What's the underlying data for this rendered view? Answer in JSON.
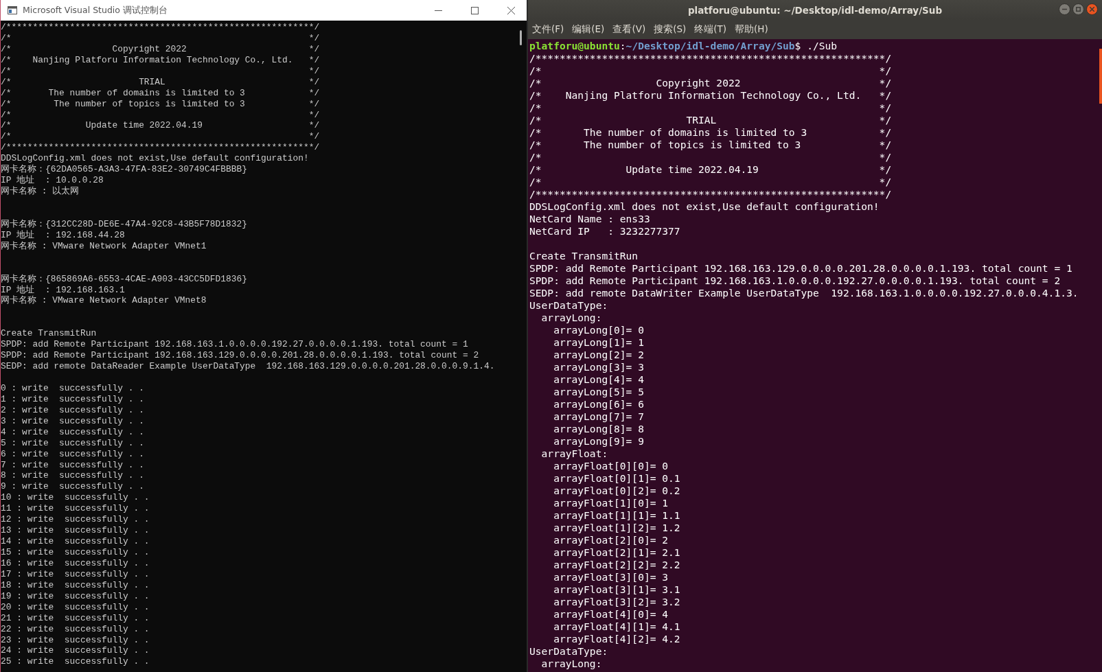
{
  "console_window": {
    "title": "Microsoft Visual Studio 调试控制台",
    "lines": [
      {
        "kind": "text",
        "text": "/**********************************************************/"
      },
      {
        "kind": "text",
        "text": "/*                                                        */"
      },
      {
        "kind": "text",
        "text": "/*                   Copyright 2022                       */"
      },
      {
        "kind": "text",
        "text": "/*    Nanjing Platforu Information Technology Co., Ltd.   */"
      },
      {
        "kind": "text",
        "text": "/*                                                        */"
      },
      {
        "kind": "text",
        "text": "/*                        TRIAL                           */"
      },
      {
        "kind": "text",
        "text": "/*       The number of domains is limited to 3            */"
      },
      {
        "kind": "text",
        "text": "/*        The number of topics is limited to 3            */"
      },
      {
        "kind": "text",
        "text": "/*                                                        */"
      },
      {
        "kind": "text",
        "text": "/*              Update time 2022.04.19                    */"
      },
      {
        "kind": "text",
        "text": "/*                                                        */"
      },
      {
        "kind": "text",
        "text": "/**********************************************************/"
      },
      {
        "kind": "text",
        "text": "DDSLogConfig.xml does not exist,Use default configuration!"
      },
      {
        "kind": "text",
        "text": "网卡名称：{62DA0565-A3A3-47FA-83E2-30749C4FBBBB}"
      },
      {
        "kind": "text",
        "text": "IP 地址  : 10.0.0.28"
      },
      {
        "kind": "text",
        "text": "网卡名称 : 以太网"
      },
      {
        "kind": "blank"
      },
      {
        "kind": "blank"
      },
      {
        "kind": "text",
        "text": "网卡名称：{312CC28D-DE6E-47A4-92C8-43B5F78D1832}"
      },
      {
        "kind": "text",
        "text": "IP 地址  : 192.168.44.28"
      },
      {
        "kind": "text",
        "text": "网卡名称 : VMware Network Adapter VMnet1"
      },
      {
        "kind": "blank"
      },
      {
        "kind": "blank"
      },
      {
        "kind": "text",
        "text": "网卡名称：{865869A6-6553-4CAE-A903-43CC5DFD1836}"
      },
      {
        "kind": "text",
        "text": "IP 地址  : 192.168.163.1"
      },
      {
        "kind": "text",
        "text": "网卡名称 : VMware Network Adapter VMnet8"
      },
      {
        "kind": "blank"
      },
      {
        "kind": "blank"
      },
      {
        "kind": "text",
        "text": "Create TransmitRun"
      },
      {
        "kind": "text",
        "text": "SPDP: add Remote Participant 192.168.163.1.0.0.0.0.192.27.0.0.0.0.1.193. total count = 1"
      },
      {
        "kind": "text",
        "text": "SPDP: add Remote Participant 192.168.163.129.0.0.0.0.201.28.0.0.0.0.1.193. total count = 2"
      },
      {
        "kind": "text",
        "text": "SEDP: add remote DataReader Example UserDataType  192.168.163.129.0.0.0.0.201.28.0.0.0.9.1.4."
      },
      {
        "kind": "blank"
      },
      {
        "kind": "text",
        "text": "0 : write  successfully . ."
      },
      {
        "kind": "text",
        "text": "1 : write  successfully . ."
      },
      {
        "kind": "text",
        "text": "2 : write  successfully . ."
      },
      {
        "kind": "text",
        "text": "3 : write  successfully . ."
      },
      {
        "kind": "text",
        "text": "4 : write  successfully . ."
      },
      {
        "kind": "text",
        "text": "5 : write  successfully . ."
      },
      {
        "kind": "text",
        "text": "6 : write  successfully . ."
      },
      {
        "kind": "text",
        "text": "7 : write  successfully . ."
      },
      {
        "kind": "text",
        "text": "8 : write  successfully . ."
      },
      {
        "kind": "text",
        "text": "9 : write  successfully . ."
      },
      {
        "kind": "text",
        "text": "10 : write  successfully . ."
      },
      {
        "kind": "text",
        "text": "11 : write  successfully . ."
      },
      {
        "kind": "text",
        "text": "12 : write  successfully . ."
      },
      {
        "kind": "text",
        "text": "13 : write  successfully . ."
      },
      {
        "kind": "text",
        "text": "14 : write  successfully . ."
      },
      {
        "kind": "text",
        "text": "15 : write  successfully . ."
      },
      {
        "kind": "text",
        "text": "16 : write  successfully . ."
      },
      {
        "kind": "text",
        "text": "17 : write  successfully . ."
      },
      {
        "kind": "text",
        "text": "18 : write  successfully . ."
      },
      {
        "kind": "text",
        "text": "19 : write  successfully . ."
      },
      {
        "kind": "text",
        "text": "20 : write  successfully . ."
      },
      {
        "kind": "text",
        "text": "21 : write  successfully . ."
      },
      {
        "kind": "text",
        "text": "22 : write  successfully . ."
      },
      {
        "kind": "text",
        "text": "23 : write  successfully . ."
      },
      {
        "kind": "text",
        "text": "24 : write  successfully . ."
      },
      {
        "kind": "text",
        "text": "25 : write  successfully . ."
      }
    ]
  },
  "terminal_window": {
    "title": "platforu@ubuntu: ~/Desktop/idl-demo/Array/Sub",
    "menu": [
      "文件(F)",
      "编辑(E)",
      "查看(V)",
      "搜索(S)",
      "终端(T)",
      "帮助(H)"
    ],
    "lines": [
      {
        "kind": "prompt",
        "user": "platforu@ubuntu",
        "separator": ":",
        "path": "~/Desktop/idl-demo/Array/Sub",
        "command": "$ ./Sub"
      },
      {
        "kind": "text",
        "text": "/**********************************************************/"
      },
      {
        "kind": "text",
        "text": "/*                                                        */"
      },
      {
        "kind": "text",
        "text": "/*                   Copyright 2022                       */"
      },
      {
        "kind": "text",
        "text": "/*    Nanjing Platforu Information Technology Co., Ltd.   */"
      },
      {
        "kind": "text",
        "text": "/*                                                        */"
      },
      {
        "kind": "text",
        "text": "/*                        TRIAL                           */"
      },
      {
        "kind": "text",
        "text": "/*       The number of domains is limited to 3            */"
      },
      {
        "kind": "text",
        "text": "/*       The number of topics is limited to 3             */"
      },
      {
        "kind": "text",
        "text": "/*                                                        */"
      },
      {
        "kind": "text",
        "text": "/*              Update time 2022.04.19                    */"
      },
      {
        "kind": "text",
        "text": "/*                                                        */"
      },
      {
        "kind": "text",
        "text": "/**********************************************************/"
      },
      {
        "kind": "text",
        "text": "DDSLogConfig.xml does not exist,Use default configuration!"
      },
      {
        "kind": "text",
        "text": "NetCard Name : ens33"
      },
      {
        "kind": "text",
        "text": "NetCard IP   : 3232277377"
      },
      {
        "kind": "blank"
      },
      {
        "kind": "text",
        "text": "Create TransmitRun"
      },
      {
        "kind": "text",
        "text": "SPDP: add Remote Participant 192.168.163.129.0.0.0.0.201.28.0.0.0.0.1.193. total count = 1"
      },
      {
        "kind": "text",
        "text": "SPDP: add Remote Participant 192.168.163.1.0.0.0.0.192.27.0.0.0.0.1.193. total count = 2"
      },
      {
        "kind": "text",
        "text": "SEDP: add remote DataWriter Example UserDataType  192.168.163.1.0.0.0.0.192.27.0.0.0.4.1.3."
      },
      {
        "kind": "text",
        "text": "UserDataType:"
      },
      {
        "kind": "text",
        "text": "  arrayLong:"
      },
      {
        "kind": "text",
        "text": "    arrayLong[0]= 0"
      },
      {
        "kind": "text",
        "text": "    arrayLong[1]= 1"
      },
      {
        "kind": "text",
        "text": "    arrayLong[2]= 2"
      },
      {
        "kind": "text",
        "text": "    arrayLong[3]= 3"
      },
      {
        "kind": "text",
        "text": "    arrayLong[4]= 4"
      },
      {
        "kind": "text",
        "text": "    arrayLong[5]= 5"
      },
      {
        "kind": "text",
        "text": "    arrayLong[6]= 6"
      },
      {
        "kind": "text",
        "text": "    arrayLong[7]= 7"
      },
      {
        "kind": "text",
        "text": "    arrayLong[8]= 8"
      },
      {
        "kind": "text",
        "text": "    arrayLong[9]= 9"
      },
      {
        "kind": "text",
        "text": "  arrayFloat:"
      },
      {
        "kind": "text",
        "text": "    arrayFloat[0][0]= 0"
      },
      {
        "kind": "text",
        "text": "    arrayFloat[0][1]= 0.1"
      },
      {
        "kind": "text",
        "text": "    arrayFloat[0][2]= 0.2"
      },
      {
        "kind": "text",
        "text": "    arrayFloat[1][0]= 1"
      },
      {
        "kind": "text",
        "text": "    arrayFloat[1][1]= 1.1"
      },
      {
        "kind": "text",
        "text": "    arrayFloat[1][2]= 1.2"
      },
      {
        "kind": "text",
        "text": "    arrayFloat[2][0]= 2"
      },
      {
        "kind": "text",
        "text": "    arrayFloat[2][1]= 2.1"
      },
      {
        "kind": "text",
        "text": "    arrayFloat[2][2]= 2.2"
      },
      {
        "kind": "text",
        "text": "    arrayFloat[3][0]= 3"
      },
      {
        "kind": "text",
        "text": "    arrayFloat[3][1]= 3.1"
      },
      {
        "kind": "text",
        "text": "    arrayFloat[3][2]= 3.2"
      },
      {
        "kind": "text",
        "text": "    arrayFloat[4][0]= 4"
      },
      {
        "kind": "text",
        "text": "    arrayFloat[4][1]= 4.1"
      },
      {
        "kind": "text",
        "text": "    arrayFloat[4][2]= 4.2"
      },
      {
        "kind": "text",
        "text": "UserDataType:"
      },
      {
        "kind": "text",
        "text": "  arrayLong:"
      }
    ]
  }
}
